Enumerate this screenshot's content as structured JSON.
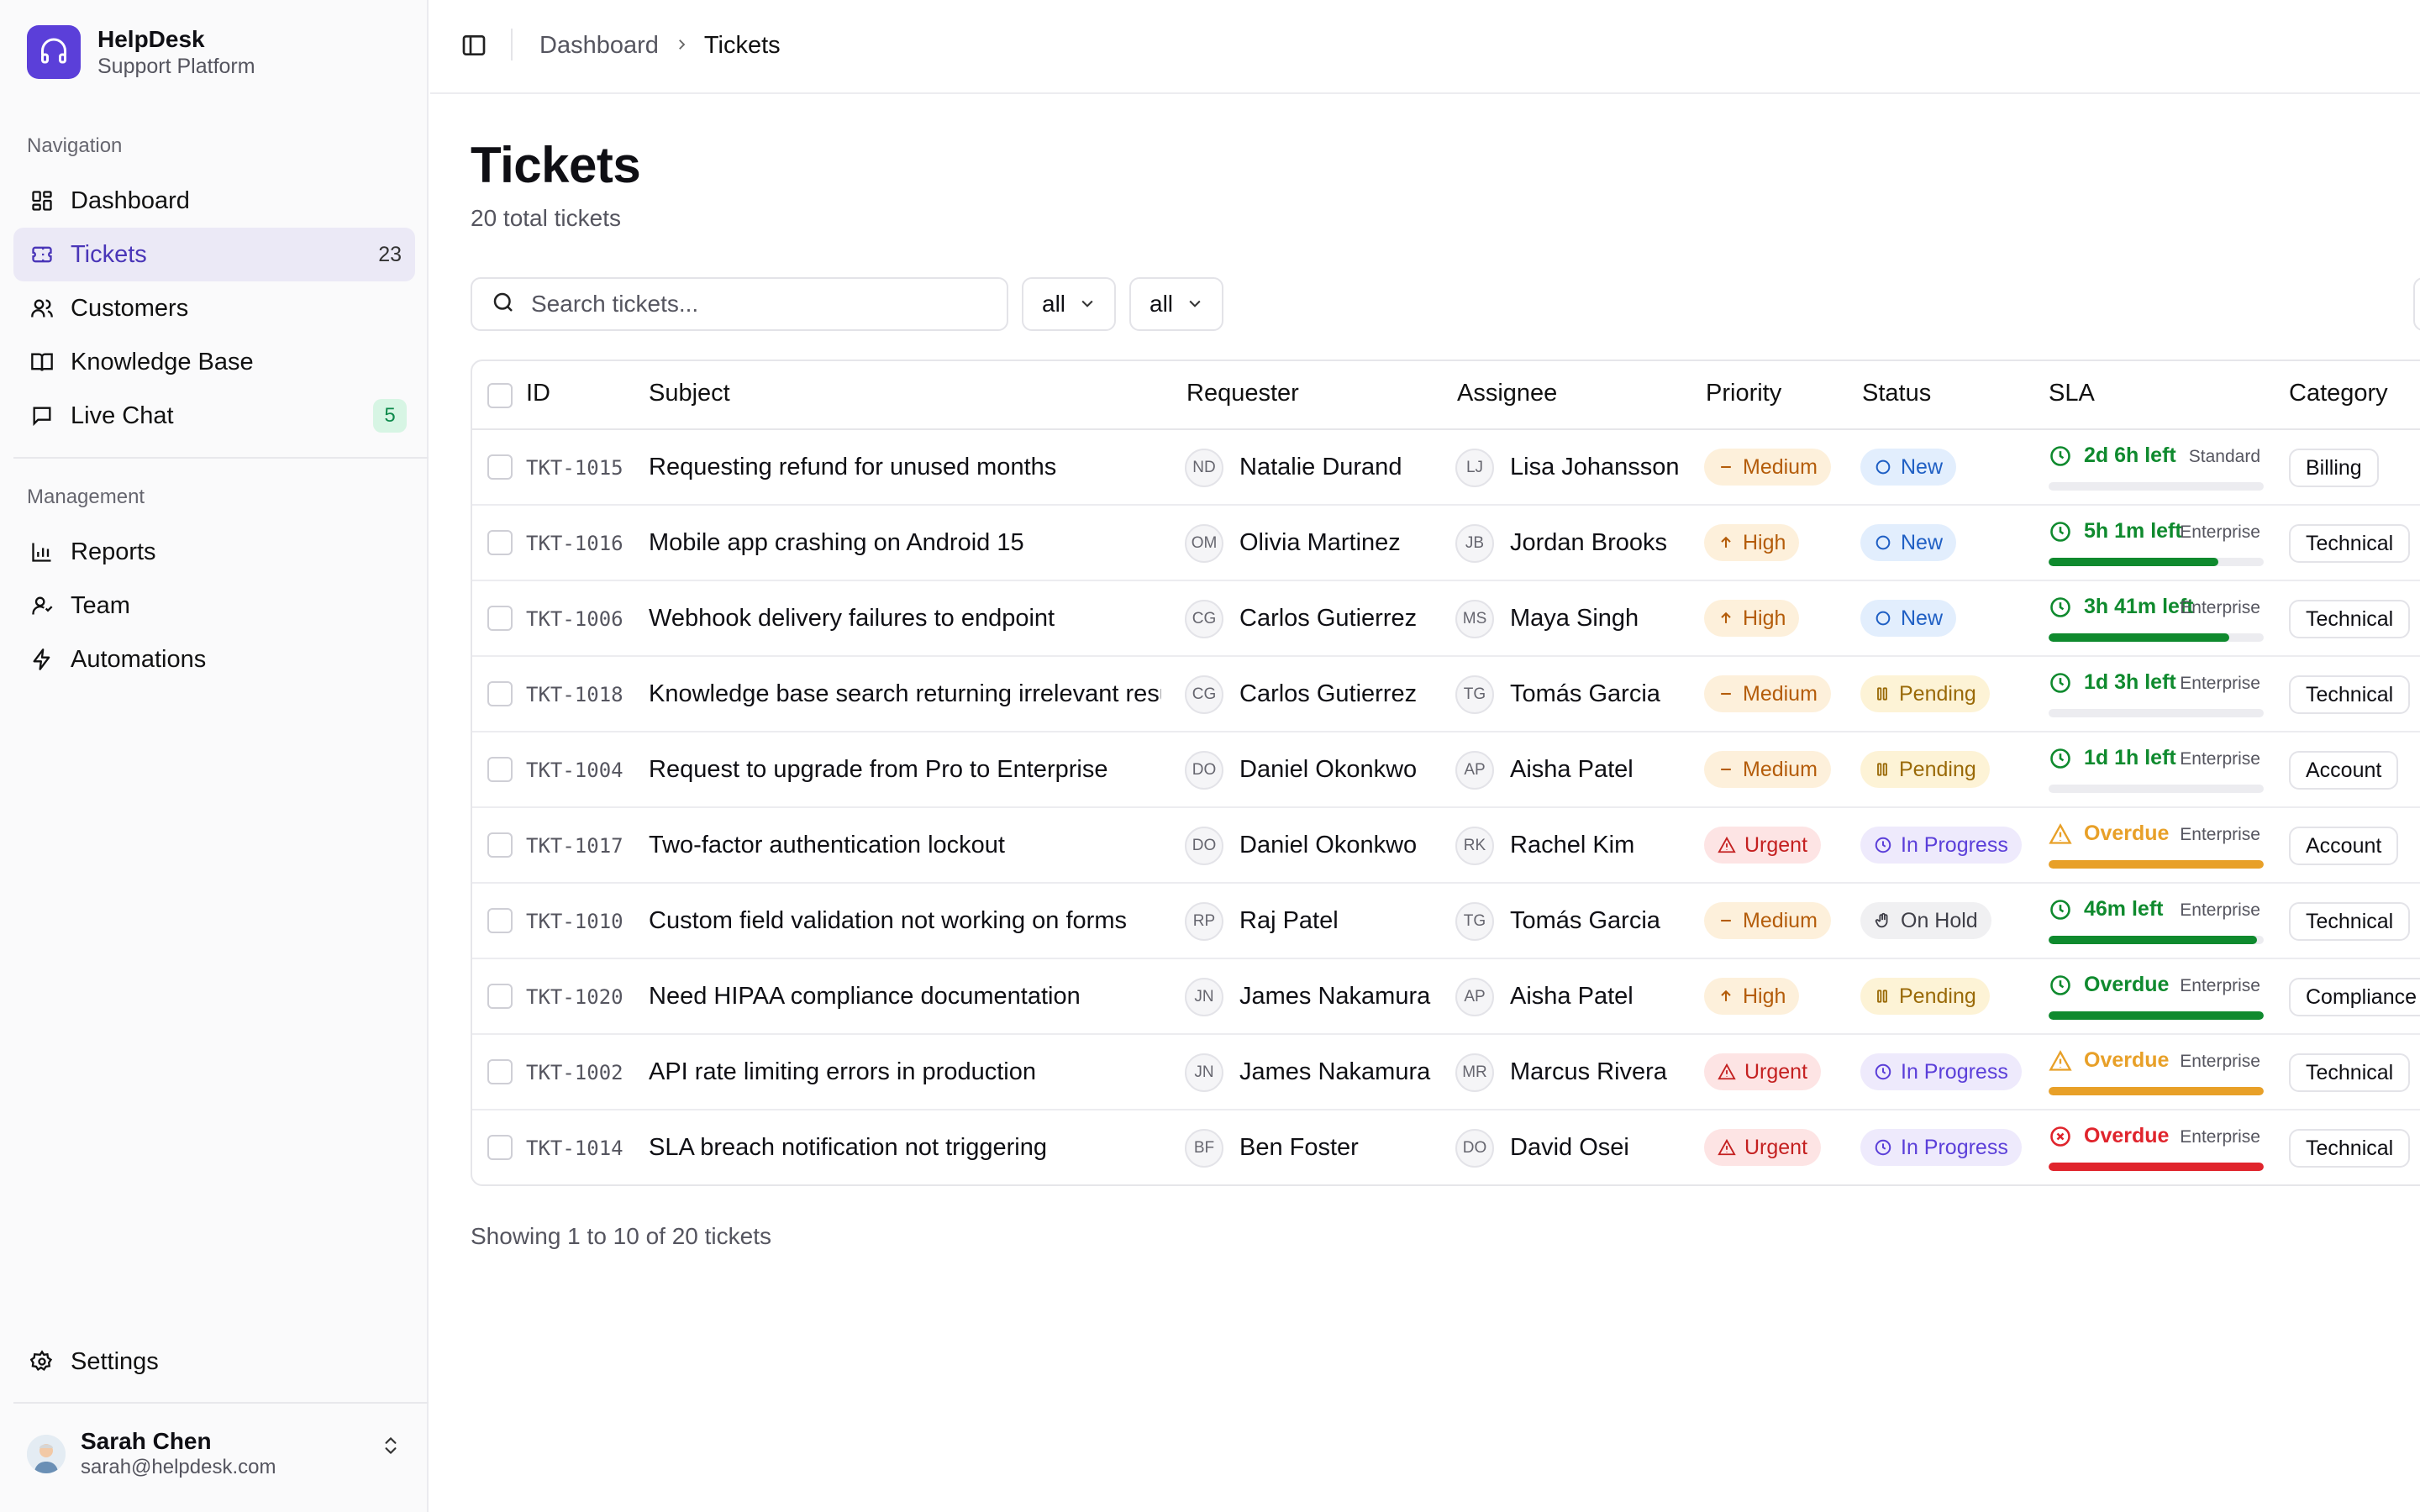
{
  "brand": {
    "name": "HelpDesk",
    "subtitle": "Support Platform"
  },
  "sidebar": {
    "section_navigation": "Navigation",
    "section_management": "Management",
    "items": [
      {
        "label": "Dashboard",
        "icon": "dashboard-icon"
      },
      {
        "label": "Tickets",
        "icon": "ticket-icon",
        "count": "23",
        "active": true
      },
      {
        "label": "Customers",
        "icon": "users-icon"
      },
      {
        "label": "Knowledge Base",
        "icon": "book-icon"
      },
      {
        "label": "Live Chat",
        "icon": "chat-icon",
        "badge": "5"
      }
    ],
    "management_items": [
      {
        "label": "Reports",
        "icon": "chart-icon"
      },
      {
        "label": "Team",
        "icon": "team-icon"
      },
      {
        "label": "Automations",
        "icon": "bolt-icon"
      }
    ],
    "settings_label": "Settings",
    "user": {
      "name": "Sarah Chen",
      "email": "sarah@helpdesk.com"
    }
  },
  "breadcrumb": {
    "parent": "Dashboard",
    "current": "Tickets"
  },
  "page": {
    "title": "Tickets",
    "subtitle": "20 total tickets"
  },
  "filters": {
    "search_placeholder": "Search tickets...",
    "status_value": "all",
    "priority_value": "all"
  },
  "table": {
    "headers": {
      "id": "ID",
      "subject": "Subject",
      "requester": "Requester",
      "assignee": "Assignee",
      "priority": "Priority",
      "status": "Status",
      "sla": "SLA",
      "category": "Category"
    },
    "rows": [
      {
        "id": "TKT-1015",
        "subject": "Requesting refund for unused months",
        "requester": "Natalie Durand",
        "req_initials": "ND",
        "assignee": "Lisa Johansson",
        "asg_initials": "LJ",
        "priority": "Medium",
        "status": "New",
        "sla": "2d 6h left",
        "sla_tier": "Standard",
        "sla_state": "ok",
        "sla_progress": 0,
        "category": "Billing"
      },
      {
        "id": "TKT-1016",
        "subject": "Mobile app crashing on Android 15",
        "requester": "Olivia Martinez",
        "req_initials": "OM",
        "assignee": "Jordan Brooks",
        "asg_initials": "JB",
        "priority": "High",
        "status": "New",
        "sla": "5h 1m left",
        "sla_tier": "Enterprise",
        "sla_state": "ok",
        "sla_progress": 0.79,
        "category": "Technical"
      },
      {
        "id": "TKT-1006",
        "subject": "Webhook delivery failures to endpoint",
        "requester": "Carlos Gutierrez",
        "req_initials": "CG",
        "assignee": "Maya Singh",
        "asg_initials": "MS",
        "priority": "High",
        "status": "New",
        "sla": "3h 41m left",
        "sla_tier": "Enterprise",
        "sla_state": "ok",
        "sla_progress": 0.84,
        "category": "Technical"
      },
      {
        "id": "TKT-1018",
        "subject": "Knowledge base search returning irrelevant results",
        "requester": "Carlos Gutierrez",
        "req_initials": "CG",
        "assignee": "Tomás Garcia",
        "asg_initials": "TG",
        "priority": "Medium",
        "status": "Pending",
        "sla": "1d 3h left",
        "sla_tier": "Enterprise",
        "sla_state": "ok",
        "sla_progress": 0,
        "category": "Technical"
      },
      {
        "id": "TKT-1004",
        "subject": "Request to upgrade from Pro to Enterprise",
        "requester": "Daniel Okonkwo",
        "req_initials": "DO",
        "assignee": "Aisha Patel",
        "asg_initials": "AP",
        "priority": "Medium",
        "status": "Pending",
        "sla": "1d 1h left",
        "sla_tier": "Enterprise",
        "sla_state": "ok",
        "sla_progress": 0,
        "category": "Account"
      },
      {
        "id": "TKT-1017",
        "subject": "Two-factor authentication lockout",
        "requester": "Daniel Okonkwo",
        "req_initials": "DO",
        "assignee": "Rachel Kim",
        "asg_initials": "RK",
        "priority": "Urgent",
        "status": "In Progress",
        "sla": "Overdue",
        "sla_tier": "Enterprise",
        "sla_state": "warn",
        "sla_progress": 1,
        "category": "Account"
      },
      {
        "id": "TKT-1010",
        "subject": "Custom field validation not working on forms",
        "requester": "Raj Patel",
        "req_initials": "RP",
        "assignee": "Tomás Garcia",
        "asg_initials": "TG",
        "priority": "Medium",
        "status": "On Hold",
        "sla": "46m left",
        "sla_tier": "Enterprise",
        "sla_state": "ok",
        "sla_progress": 0.97,
        "category": "Technical"
      },
      {
        "id": "TKT-1020",
        "subject": "Need HIPAA compliance documentation",
        "requester": "James Nakamura",
        "req_initials": "JN",
        "assignee": "Aisha Patel",
        "asg_initials": "AP",
        "priority": "High",
        "status": "Pending",
        "sla": "Overdue",
        "sla_tier": "Enterprise",
        "sla_state": "ok",
        "sla_progress": 1,
        "category": "Compliance"
      },
      {
        "id": "TKT-1002",
        "subject": "API rate limiting errors in production",
        "requester": "James Nakamura",
        "req_initials": "JN",
        "assignee": "Marcus Rivera",
        "asg_initials": "MR",
        "priority": "Urgent",
        "status": "In Progress",
        "sla": "Overdue",
        "sla_tier": "Enterprise",
        "sla_state": "warn",
        "sla_progress": 1,
        "category": "Technical"
      },
      {
        "id": "TKT-1014",
        "subject": "SLA breach notification not triggering",
        "requester": "Ben Foster",
        "req_initials": "BF",
        "assignee": "David Osei",
        "asg_initials": "DO",
        "priority": "Urgent",
        "status": "In Progress",
        "sla": "Overdue",
        "sla_tier": "Enterprise",
        "sla_state": "breach",
        "sla_progress": 1,
        "category": "Technical"
      }
    ]
  },
  "footer": {
    "pagination_text": "Showing 1 to 10 of 20 tickets"
  },
  "colors": {
    "accent": "#5b3fd9",
    "sla_ok": "#0f8a2e",
    "sla_warn": "#e8a028",
    "sla_breach": "#e0242c"
  }
}
